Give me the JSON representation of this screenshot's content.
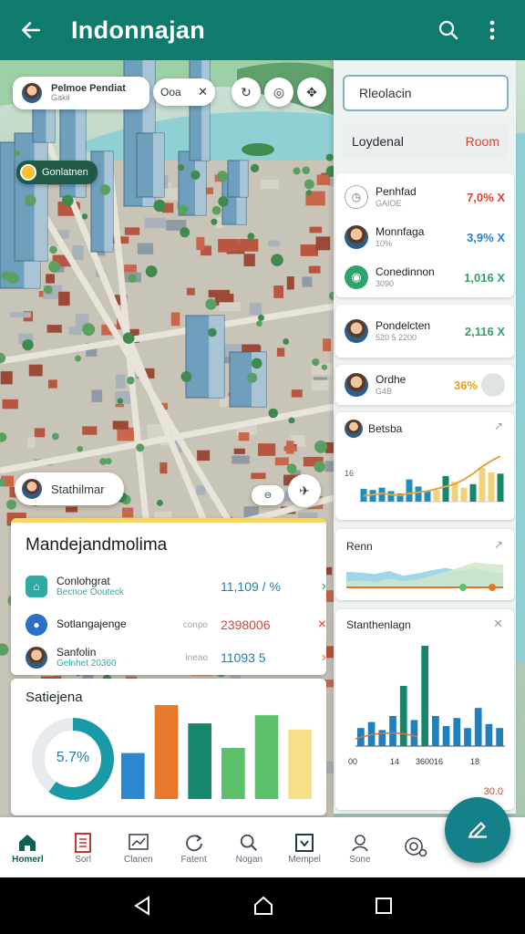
{
  "appbar": {
    "title": "Indonnajan",
    "back_icon": "arrow-left-icon",
    "search_icon": "search-icon",
    "menu_icon": "more-vert-icon"
  },
  "map": {
    "profile_chip": {
      "name": "Pelmoe Pendiat",
      "sub": "Gakil"
    },
    "top_chip_label": "Ooa",
    "place_pill": "Gonlatnen",
    "person_chip": "Stathilmar"
  },
  "right_panel": {
    "search_value": "Rleolacin",
    "filter_label": "Loydenal",
    "filter_action": "Room",
    "items": [
      {
        "name": "Penhfad",
        "sub": "GAIOE",
        "value": "7,0% X",
        "color": "#d9442f"
      },
      {
        "name": "Monnfaga",
        "sub": "10%",
        "value": "3,9% X",
        "color": "#2b7fcf"
      },
      {
        "name": "Conedinnon",
        "sub": "3090",
        "value": "1,016 X",
        "color": "#2ea36a"
      },
      {
        "name": "Pondelcten",
        "sub": "520 5 2200",
        "value": "2,116 X",
        "color": "#2ea36a"
      },
      {
        "name": "Ordhe",
        "sub": "G4B",
        "value": "36%",
        "color": "#e0a21e"
      }
    ],
    "bar_card": {
      "title": "Betsba",
      "y_tick": "16"
    },
    "area_card": {
      "title": "Renn"
    },
    "stat_card": {
      "title": "Stanthenlagn",
      "x_ticks": [
        "00",
        "14",
        "360016",
        "18"
      ],
      "footer_value": "30.0"
    }
  },
  "main_card": {
    "title": "Mandejandmolima",
    "rows": [
      {
        "name": "Conlohgrat",
        "sub": "Becnoe Oouteck",
        "mid": "",
        "value": "11,109 / %",
        "color": "#1e7fae",
        "arrow": "›"
      },
      {
        "name": "Sotlangajenge",
        "sub": "",
        "mid": "conpo",
        "value": "2398006",
        "color": "#d9442f",
        "arrow": "×"
      },
      {
        "name": "Sanfolin",
        "sub": "Gelnhet 20360",
        "mid": "lneao",
        "value": "11093 5",
        "color": "#1e7fae",
        "arrow": "›"
      }
    ]
  },
  "stat_card": {
    "title": "Satiejena",
    "donut_label": "5.7%",
    "donut_fraction": 0.6
  },
  "chart_data": [
    {
      "type": "bar",
      "title": "Betsba",
      "values": [
        22,
        20,
        24,
        18,
        14,
        38,
        26,
        18,
        20,
        44,
        34,
        24,
        30,
        58,
        50,
        48
      ],
      "trend": [
        10,
        12,
        14,
        12,
        11,
        14,
        16,
        18,
        22,
        26,
        30,
        38,
        48,
        60,
        70,
        78
      ],
      "ylim": [
        0,
        100
      ]
    },
    {
      "type": "area",
      "title": "Renn",
      "series": [
        {
          "values": [
            40,
            38,
            34,
            42,
            30,
            36,
            44,
            50,
            42,
            48,
            40,
            36
          ]
        },
        {
          "values": [
            16,
            18,
            14,
            22,
            16,
            20,
            30,
            40,
            52,
            64,
            60,
            58
          ]
        }
      ]
    },
    {
      "type": "bar",
      "title": "Stanthenlagn",
      "values": [
        18,
        24,
        16,
        30,
        60,
        26,
        100,
        30,
        20,
        28,
        18,
        38,
        22,
        18
      ],
      "ylim": [
        0,
        100
      ]
    },
    {
      "type": "bar",
      "title": "Satiejena",
      "values": [
        45,
        92,
        74,
        50,
        82,
        68
      ],
      "colors": [
        "#2a87d0",
        "#e8782a",
        "#17876b",
        "#5cbf6a",
        "#5cbf6a",
        "#f4de86"
      ],
      "ylim": [
        0,
        100
      ]
    }
  ],
  "bottom_nav": [
    {
      "label": "Homerl",
      "icon": "home-icon",
      "active": true
    },
    {
      "label": "Sorl",
      "icon": "document-icon",
      "active": false
    },
    {
      "label": "Clanen",
      "icon": "chart-icon",
      "active": false
    },
    {
      "label": "Fatent",
      "icon": "refresh-icon",
      "active": false
    },
    {
      "label": "Nogan",
      "icon": "search-icon",
      "active": false
    },
    {
      "label": "Mempel",
      "icon": "map-icon",
      "active": false
    },
    {
      "label": "Sone",
      "icon": "profile-icon",
      "active": false
    },
    {
      "label": "",
      "icon": "settings-icon",
      "active": false
    }
  ],
  "fab": {
    "icon": "edit-icon"
  }
}
